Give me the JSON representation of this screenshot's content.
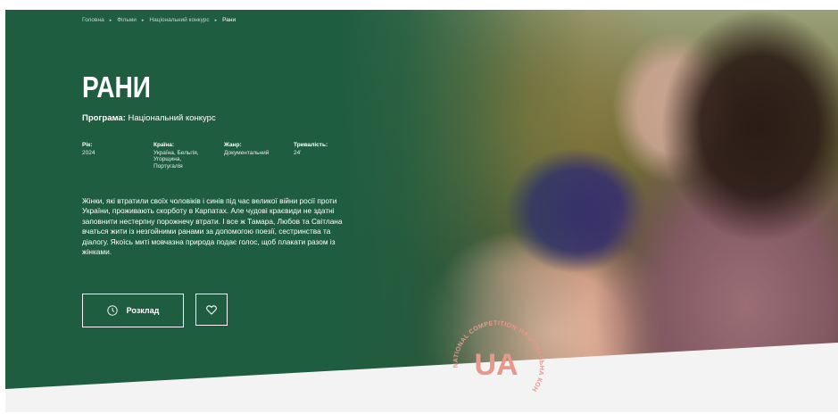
{
  "breadcrumb": {
    "items": [
      "Головна",
      "Фільми",
      "Національний конкурс",
      "Рани"
    ],
    "separator": "▸"
  },
  "film": {
    "title": "РАНИ",
    "program_label": "Програма:",
    "program_value": "Національний конкурс",
    "meta": {
      "year_label": "Рік:",
      "year_value": "2024",
      "country_label": "Країна:",
      "country_value": "Україна, Бельгія, Угорщина, Португалія",
      "genre_label": "Жанр:",
      "genre_value": "Документальний",
      "duration_label": "Тривалість:",
      "duration_value": "24'"
    },
    "description": "Жінки, які втратили своїх чоловіків і синів під час великої війни росії проти України, проживають скорботу в Карпатах. Але чудові краєвиди не здатні заповнити нестерпну порожнечу втрати. І все ж Тамара, Любов та Світлана вчаться жити із незгойними ранами за допомогою поезії, сестринства та діалогу. Якоїсь миті мовчазна природа подає голос, щоб плакати разом із жінками."
  },
  "actions": {
    "schedule_label": "Розклад",
    "schedule_icon": "clock-icon",
    "favorite_icon": "heart-icon"
  },
  "seal": {
    "center_text": "UA",
    "ring_text_top": "NATIONAL COMPETITION PROGRAM",
    "ring_text_right": "НАЦІОНАЛЬНА КОНКУРСНА ПРОГРАМА"
  },
  "colors": {
    "brand_green": "#1f5d40",
    "seal_color": "#e8978a",
    "page_bg": "#f3f3f3"
  }
}
